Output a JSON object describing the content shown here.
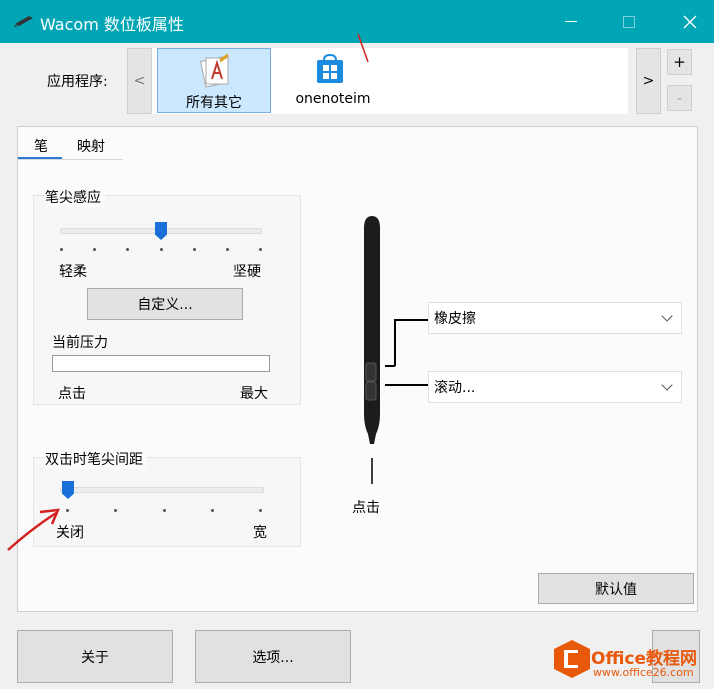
{
  "window": {
    "title": "Wacom 数位板属性",
    "colors": {
      "titlebar": "#00a6b6",
      "accent": "#1a6fd8"
    }
  },
  "app_row": {
    "label": "应用程序:",
    "prev_label": "<",
    "next_label": ">",
    "add_label": "+",
    "remove_label": "-",
    "apps": [
      {
        "label": "所有其它",
        "icon": "all-apps-icon",
        "selected": true
      },
      {
        "label": "onenoteim",
        "icon": "store-icon",
        "selected": false
      }
    ]
  },
  "tabs": [
    {
      "label": "笔",
      "selected": true
    },
    {
      "label": "映射",
      "selected": false
    }
  ],
  "tip_feel": {
    "title": "笔尖感应",
    "soft_label": "轻柔",
    "firm_label": "坚硬",
    "level": 0.5,
    "customize_label": "自定义...",
    "pressure_title": "当前压力",
    "click_label": "点击",
    "max_label": "最大",
    "current_pressure": 0
  },
  "double_click": {
    "title": "双击时笔尖间距",
    "off_label": "关闭",
    "wide_label": "宽",
    "level": 0
  },
  "pen": {
    "upper_button_value": "橡皮擦",
    "lower_button_value": "滚动...",
    "tip_value": "点击"
  },
  "buttons": {
    "default_label": "默认值",
    "about_label": "关于",
    "options_label": "选项..."
  },
  "watermark": {
    "text": "Office教程网",
    "url": "www.office26.com"
  }
}
